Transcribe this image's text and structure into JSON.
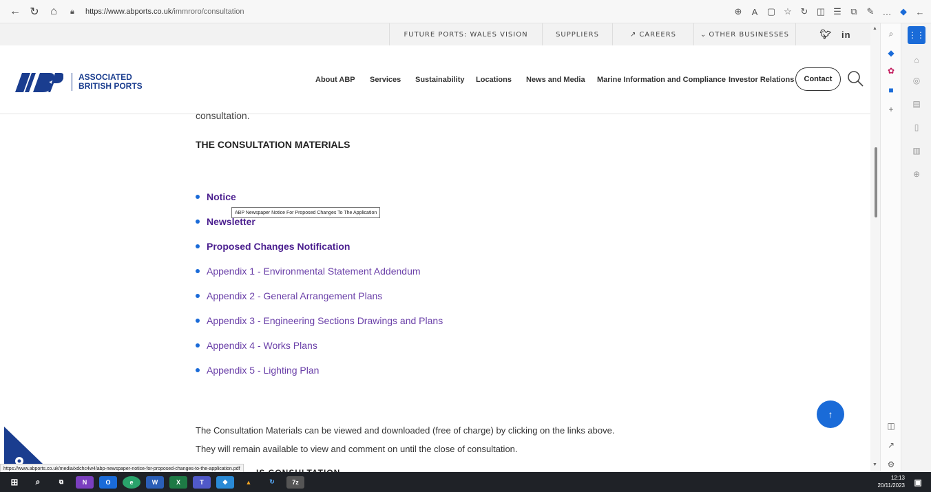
{
  "browser": {
    "url_host": "https://www.abports.co.uk",
    "url_path": "/immroro/consultation",
    "status_url": "https://www.abports.co.uk/media/xdchc4w4/abp-newspaper-notice-for-proposed-changes-to-the-application.pdf"
  },
  "top_strip": {
    "items": [
      "FUTURE PORTS: WALES VISION",
      "SUPPLIERS",
      "CAREERS",
      "OTHER BUSINESSES"
    ]
  },
  "header": {
    "logo_line1": "ASSOCIATED",
    "logo_line2": "BRITISH PORTS",
    "nav": [
      "About ABP",
      "Services",
      "Sustainability",
      "Locations",
      "News and Media",
      "Marine Information and Compliance",
      "Investor Relations"
    ],
    "contact_label": "Contact"
  },
  "content": {
    "cut_text": "consultation.",
    "section_title": "THE CONSULTATION MATERIALS",
    "tooltip": "ABP Newspaper Notice For Proposed Changes To The Application",
    "materials_bold": [
      "Notice",
      "Newsletter",
      "Proposed Changes Notification"
    ],
    "materials": [
      "Appendix 1 - Environmental Statement Addendum",
      "Appendix 2 - General Arrangement Plans",
      "Appendix 3 - Engineering Sections Drawings and Plans",
      "Appendix 4 - Works Plans",
      "Appendix 5 - Lighting Plan"
    ],
    "para1": "The Consultation Materials can be viewed and downloaded (free of charge) by clicking on the links above.",
    "para2": "They will remain available to view and comment on until the close of consultation.",
    "partial_heading": "IS CONSULTATION"
  },
  "taskbar": {
    "time": "12:13",
    "date": "20/11/2023"
  },
  "colors": {
    "brand_blue": "#1a3d8f",
    "link_purple": "#4b1f8f",
    "accent_blue": "#1a6bd8"
  }
}
